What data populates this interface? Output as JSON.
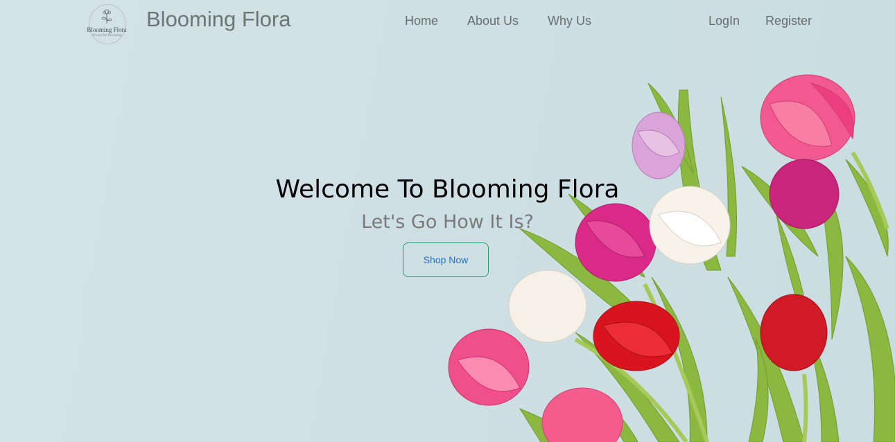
{
  "header": {
    "logo": {
      "name": "Blooming Flora",
      "tagline": "Always Be Blooming"
    },
    "brand": "Blooming Flora",
    "nav": [
      "Home",
      "About Us",
      "Why Us"
    ],
    "auth": {
      "login": "LogIn",
      "register": "Register"
    }
  },
  "hero": {
    "title": "Welcome To Blooming Flora",
    "subtitle": "Let's Go How It Is?",
    "cta": "Shop Now"
  },
  "colors": {
    "background": "#d3e2e5",
    "cta_border": "#23a06b",
    "cta_text": "#1e73c8",
    "tulip_pink": "#e8337a",
    "tulip_red": "#d8141e",
    "tulip_white": "#f7f2ea",
    "tulip_lilac": "#d9a5d8",
    "leaf": "#8bb940"
  }
}
